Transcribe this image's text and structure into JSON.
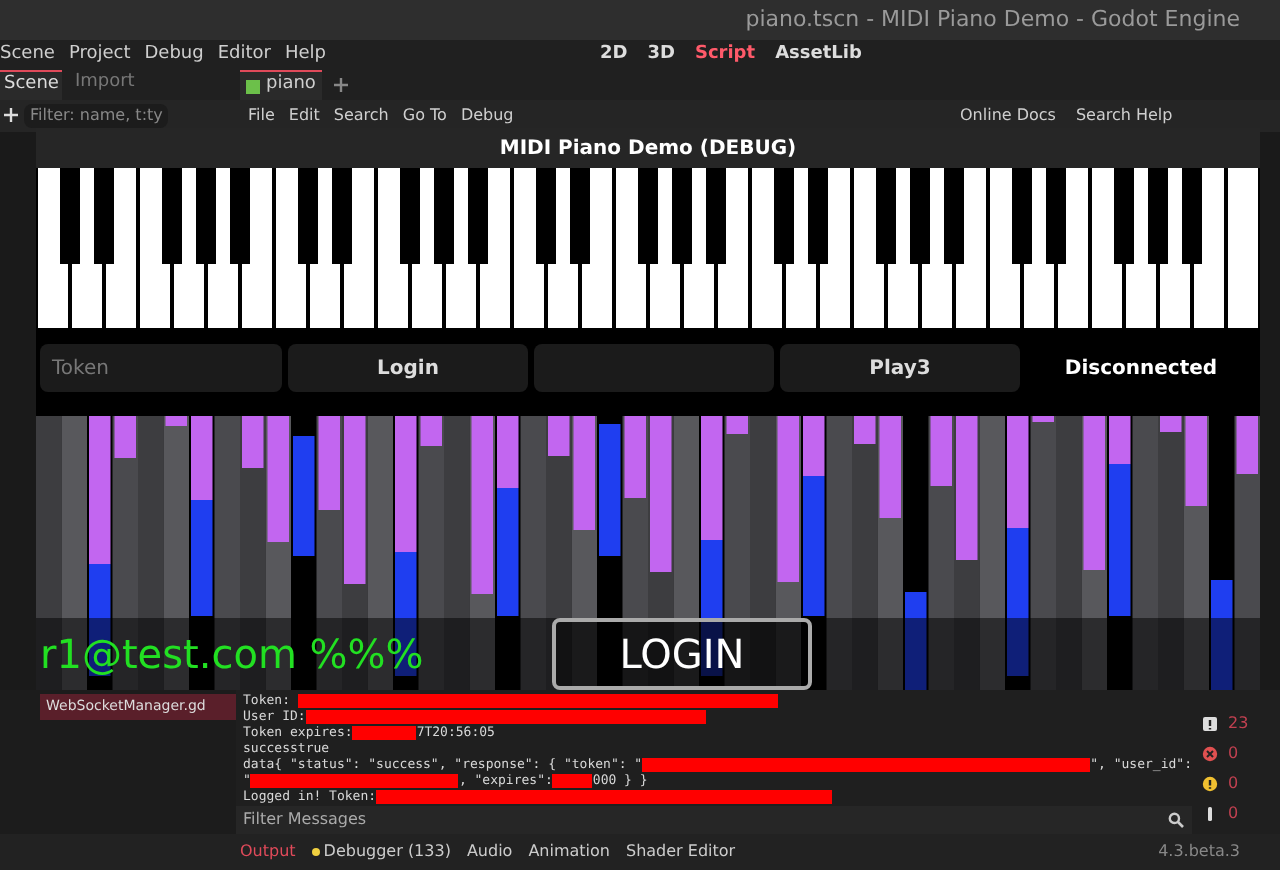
{
  "window": {
    "title": "piano.tscn - MIDI Piano Demo - Godot Engine"
  },
  "menu": [
    "Scene",
    "Project",
    "Debug",
    "Editor",
    "Help"
  ],
  "workspaces": [
    {
      "label": "2D",
      "selected": false
    },
    {
      "label": "3D",
      "selected": false
    },
    {
      "label": "Script",
      "selected": true
    },
    {
      "label": "AssetLib",
      "selected": false
    }
  ],
  "dock_tabs": [
    {
      "label": "Scene",
      "selected": true
    },
    {
      "label": "Import",
      "selected": false
    }
  ],
  "scene_filter": {
    "placeholder": "Filter: name, t:ty"
  },
  "script_tabs": [
    {
      "label": "piano",
      "selected": true
    }
  ],
  "script_menu": [
    "File",
    "Edit",
    "Search",
    "Go To",
    "Debug"
  ],
  "script_links": [
    "Online Docs",
    "Search Help"
  ],
  "game": {
    "title": "MIDI Piano Demo (DEBUG)",
    "token_field": {
      "placeholder": "Token"
    },
    "buttons": [
      {
        "kind": "labeled",
        "label": "Login"
      },
      {
        "kind": "blank"
      },
      {
        "kind": "labeled",
        "label": "Play3"
      }
    ],
    "status": "Disconnected",
    "email": "r1@test.com %%%",
    "login_button": "LOGIN"
  },
  "file_row": "WebSocketManager.gd",
  "console": [
    [
      {
        "kind": "text",
        "text": "Token: "
      },
      {
        "kind": "redacted"
      }
    ],
    [
      {
        "kind": "text",
        "text": "User ID:"
      },
      {
        "kind": "redacted"
      }
    ],
    [
      {
        "kind": "text",
        "text": "Token expires:"
      },
      {
        "kind": "redacted"
      },
      {
        "kind": "text",
        "text": "7T20:56:05"
      }
    ],
    [
      {
        "kind": "text",
        "text": "successtrue"
      }
    ],
    [
      {
        "kind": "text",
        "text": "data{ \"status\": \"success\", \"response\": { \"token\": \""
      },
      {
        "kind": "redacted"
      },
      {
        "kind": "text",
        "text": "\", \"user_id\":"
      }
    ],
    [
      {
        "kind": "text",
        "text": "\""
      },
      {
        "kind": "redacted"
      },
      {
        "kind": "text",
        "text": ", \"expires\":"
      },
      {
        "kind": "redacted"
      },
      {
        "kind": "text",
        "text": "000 } }"
      }
    ],
    [
      {
        "kind": "text",
        "text": "Logged in! Token:"
      },
      {
        "kind": "redacted"
      }
    ]
  ],
  "counters": [
    {
      "kind": "messages",
      "count": "23"
    },
    {
      "kind": "errors",
      "count": "0"
    },
    {
      "kind": "warnings",
      "count": "0"
    },
    {
      "kind": "info",
      "count": "0"
    }
  ],
  "filter": {
    "placeholder": "Filter Messages"
  },
  "bottom_tabs": [
    {
      "label": "Output",
      "selected": true,
      "dot": false
    },
    {
      "label": "Debugger (133)",
      "selected": false,
      "dot": true
    },
    {
      "label": "Audio",
      "selected": false,
      "dot": false
    },
    {
      "label": "Animation",
      "selected": false,
      "dot": false
    },
    {
      "label": "Shader Editor",
      "selected": false,
      "dot": false
    }
  ],
  "version": "4.3.beta.3"
}
